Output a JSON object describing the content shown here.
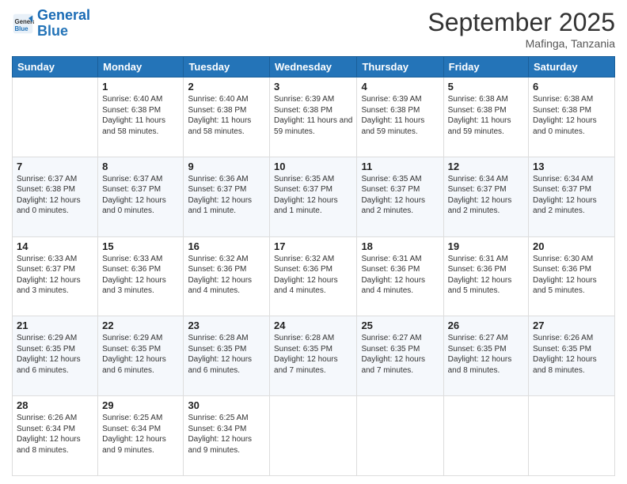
{
  "header": {
    "logo_line1": "General",
    "logo_line2": "Blue",
    "month": "September 2025",
    "location": "Mafinga, Tanzania"
  },
  "days_of_week": [
    "Sunday",
    "Monday",
    "Tuesday",
    "Wednesday",
    "Thursday",
    "Friday",
    "Saturday"
  ],
  "weeks": [
    [
      {
        "day": "",
        "content": ""
      },
      {
        "day": "1",
        "content": "Sunrise: 6:40 AM\nSunset: 6:38 PM\nDaylight: 11 hours\nand 58 minutes."
      },
      {
        "day": "2",
        "content": "Sunrise: 6:40 AM\nSunset: 6:38 PM\nDaylight: 11 hours\nand 58 minutes."
      },
      {
        "day": "3",
        "content": "Sunrise: 6:39 AM\nSunset: 6:38 PM\nDaylight: 11 hours\nand 59 minutes."
      },
      {
        "day": "4",
        "content": "Sunrise: 6:39 AM\nSunset: 6:38 PM\nDaylight: 11 hours\nand 59 minutes."
      },
      {
        "day": "5",
        "content": "Sunrise: 6:38 AM\nSunset: 6:38 PM\nDaylight: 11 hours\nand 59 minutes."
      },
      {
        "day": "6",
        "content": "Sunrise: 6:38 AM\nSunset: 6:38 PM\nDaylight: 12 hours\nand 0 minutes."
      }
    ],
    [
      {
        "day": "7",
        "content": "Sunrise: 6:37 AM\nSunset: 6:38 PM\nDaylight: 12 hours\nand 0 minutes."
      },
      {
        "day": "8",
        "content": "Sunrise: 6:37 AM\nSunset: 6:37 PM\nDaylight: 12 hours\nand 0 minutes."
      },
      {
        "day": "9",
        "content": "Sunrise: 6:36 AM\nSunset: 6:37 PM\nDaylight: 12 hours\nand 1 minute."
      },
      {
        "day": "10",
        "content": "Sunrise: 6:35 AM\nSunset: 6:37 PM\nDaylight: 12 hours\nand 1 minute."
      },
      {
        "day": "11",
        "content": "Sunrise: 6:35 AM\nSunset: 6:37 PM\nDaylight: 12 hours\nand 2 minutes."
      },
      {
        "day": "12",
        "content": "Sunrise: 6:34 AM\nSunset: 6:37 PM\nDaylight: 12 hours\nand 2 minutes."
      },
      {
        "day": "13",
        "content": "Sunrise: 6:34 AM\nSunset: 6:37 PM\nDaylight: 12 hours\nand 2 minutes."
      }
    ],
    [
      {
        "day": "14",
        "content": "Sunrise: 6:33 AM\nSunset: 6:37 PM\nDaylight: 12 hours\nand 3 minutes."
      },
      {
        "day": "15",
        "content": "Sunrise: 6:33 AM\nSunset: 6:36 PM\nDaylight: 12 hours\nand 3 minutes."
      },
      {
        "day": "16",
        "content": "Sunrise: 6:32 AM\nSunset: 6:36 PM\nDaylight: 12 hours\nand 4 minutes."
      },
      {
        "day": "17",
        "content": "Sunrise: 6:32 AM\nSunset: 6:36 PM\nDaylight: 12 hours\nand 4 minutes."
      },
      {
        "day": "18",
        "content": "Sunrise: 6:31 AM\nSunset: 6:36 PM\nDaylight: 12 hours\nand 4 minutes."
      },
      {
        "day": "19",
        "content": "Sunrise: 6:31 AM\nSunset: 6:36 PM\nDaylight: 12 hours\nand 5 minutes."
      },
      {
        "day": "20",
        "content": "Sunrise: 6:30 AM\nSunset: 6:36 PM\nDaylight: 12 hours\nand 5 minutes."
      }
    ],
    [
      {
        "day": "21",
        "content": "Sunrise: 6:29 AM\nSunset: 6:35 PM\nDaylight: 12 hours\nand 6 minutes."
      },
      {
        "day": "22",
        "content": "Sunrise: 6:29 AM\nSunset: 6:35 PM\nDaylight: 12 hours\nand 6 minutes."
      },
      {
        "day": "23",
        "content": "Sunrise: 6:28 AM\nSunset: 6:35 PM\nDaylight: 12 hours\nand 6 minutes."
      },
      {
        "day": "24",
        "content": "Sunrise: 6:28 AM\nSunset: 6:35 PM\nDaylight: 12 hours\nand 7 minutes."
      },
      {
        "day": "25",
        "content": "Sunrise: 6:27 AM\nSunset: 6:35 PM\nDaylight: 12 hours\nand 7 minutes."
      },
      {
        "day": "26",
        "content": "Sunrise: 6:27 AM\nSunset: 6:35 PM\nDaylight: 12 hours\nand 8 minutes."
      },
      {
        "day": "27",
        "content": "Sunrise: 6:26 AM\nSunset: 6:35 PM\nDaylight: 12 hours\nand 8 minutes."
      }
    ],
    [
      {
        "day": "28",
        "content": "Sunrise: 6:26 AM\nSunset: 6:34 PM\nDaylight: 12 hours\nand 8 minutes."
      },
      {
        "day": "29",
        "content": "Sunrise: 6:25 AM\nSunset: 6:34 PM\nDaylight: 12 hours\nand 9 minutes."
      },
      {
        "day": "30",
        "content": "Sunrise: 6:25 AM\nSunset: 6:34 PM\nDaylight: 12 hours\nand 9 minutes."
      },
      {
        "day": "",
        "content": ""
      },
      {
        "day": "",
        "content": ""
      },
      {
        "day": "",
        "content": ""
      },
      {
        "day": "",
        "content": ""
      }
    ]
  ]
}
